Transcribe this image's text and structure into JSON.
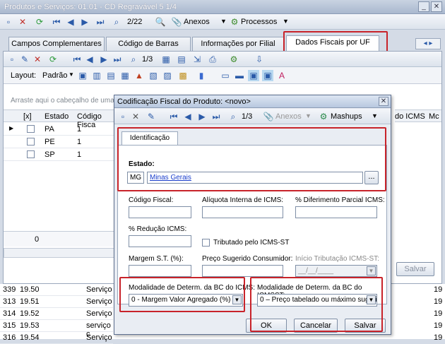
{
  "window": {
    "title": "Produtos e Serviços: 01.01 - CD Regravável 5 1/4"
  },
  "main_toolbar": {
    "record": "2/22",
    "anexos": "Anexos",
    "processos": "Processos"
  },
  "tabs": [
    {
      "label": "Campos Complementares"
    },
    {
      "label": "Código de Barras"
    },
    {
      "label": "Informações por Filial"
    },
    {
      "label": "Dados Fiscais por UF"
    }
  ],
  "sub_toolbar": {
    "record": "1/3"
  },
  "layout_bar": {
    "label": "Layout:",
    "value": "Padrão"
  },
  "group_hint": "Arraste aqui o cabeçalho de uma c",
  "grid": {
    "headers": [
      "[x]",
      "Estado",
      "Código Fisca"
    ],
    "rows": [
      {
        "estado": "PA",
        "codigo": "1"
      },
      {
        "estado": "PE",
        "codigo": "1"
      },
      {
        "estado": "SP",
        "codigo": "1"
      }
    ],
    "right_headers": [
      "do ICMS",
      "Mc"
    ],
    "footer_count": "0"
  },
  "bottom_table": {
    "rows": [
      {
        "id": "339",
        "code": "19.50",
        "tipo": "Serviço"
      },
      {
        "id": "313",
        "code": "19.51",
        "tipo": "Serviço"
      },
      {
        "id": "314",
        "code": "19.52",
        "tipo": "Serviço"
      },
      {
        "id": "315",
        "code": "19.53",
        "tipo": "serviço c"
      },
      {
        "id": "316",
        "code": "19.54",
        "tipo": "Serviço"
      }
    ],
    "right_col": [
      "19",
      "19",
      "19",
      "19",
      "19"
    ]
  },
  "salvar_bg": "Salvar",
  "dialog": {
    "title": "Codificação Fiscal do Produto: <novo>",
    "record": "1/3",
    "anexos": "Anexos",
    "mashups": "Mashups",
    "tab": "Identificação",
    "estado_label": "Estado:",
    "estado_code": "MG",
    "estado_name": "Minas Gerais",
    "fields": {
      "codigo_fiscal": "Código Fiscal:",
      "aliquota": "Alíquota Interna de ICMS:",
      "diferimento": "% Diferimento Parcial ICMS:",
      "reducao": "% Redução ICMS:",
      "tributado": "Tributado pelo ICMS-ST",
      "margem": "Margem S.T. (%):",
      "preco": "Preço Sugerido Consumidor:",
      "inicio": "Início Tributação ICMS-ST:",
      "inicio_value": "__/__/____"
    },
    "modalidade_icms": {
      "label": "Modalidade de Determ. da BC do ICMS:",
      "value": "0 - Margem Valor Agregado (%)"
    },
    "modalidade_icmsst": {
      "label": "Modalidade de Determ. da BC do ICMSST:",
      "value": "0 – Preço tabelado ou máximo sugeri"
    },
    "buttons": {
      "ok": "OK",
      "cancelar": "Cancelar",
      "salvar": "Salvar"
    }
  }
}
